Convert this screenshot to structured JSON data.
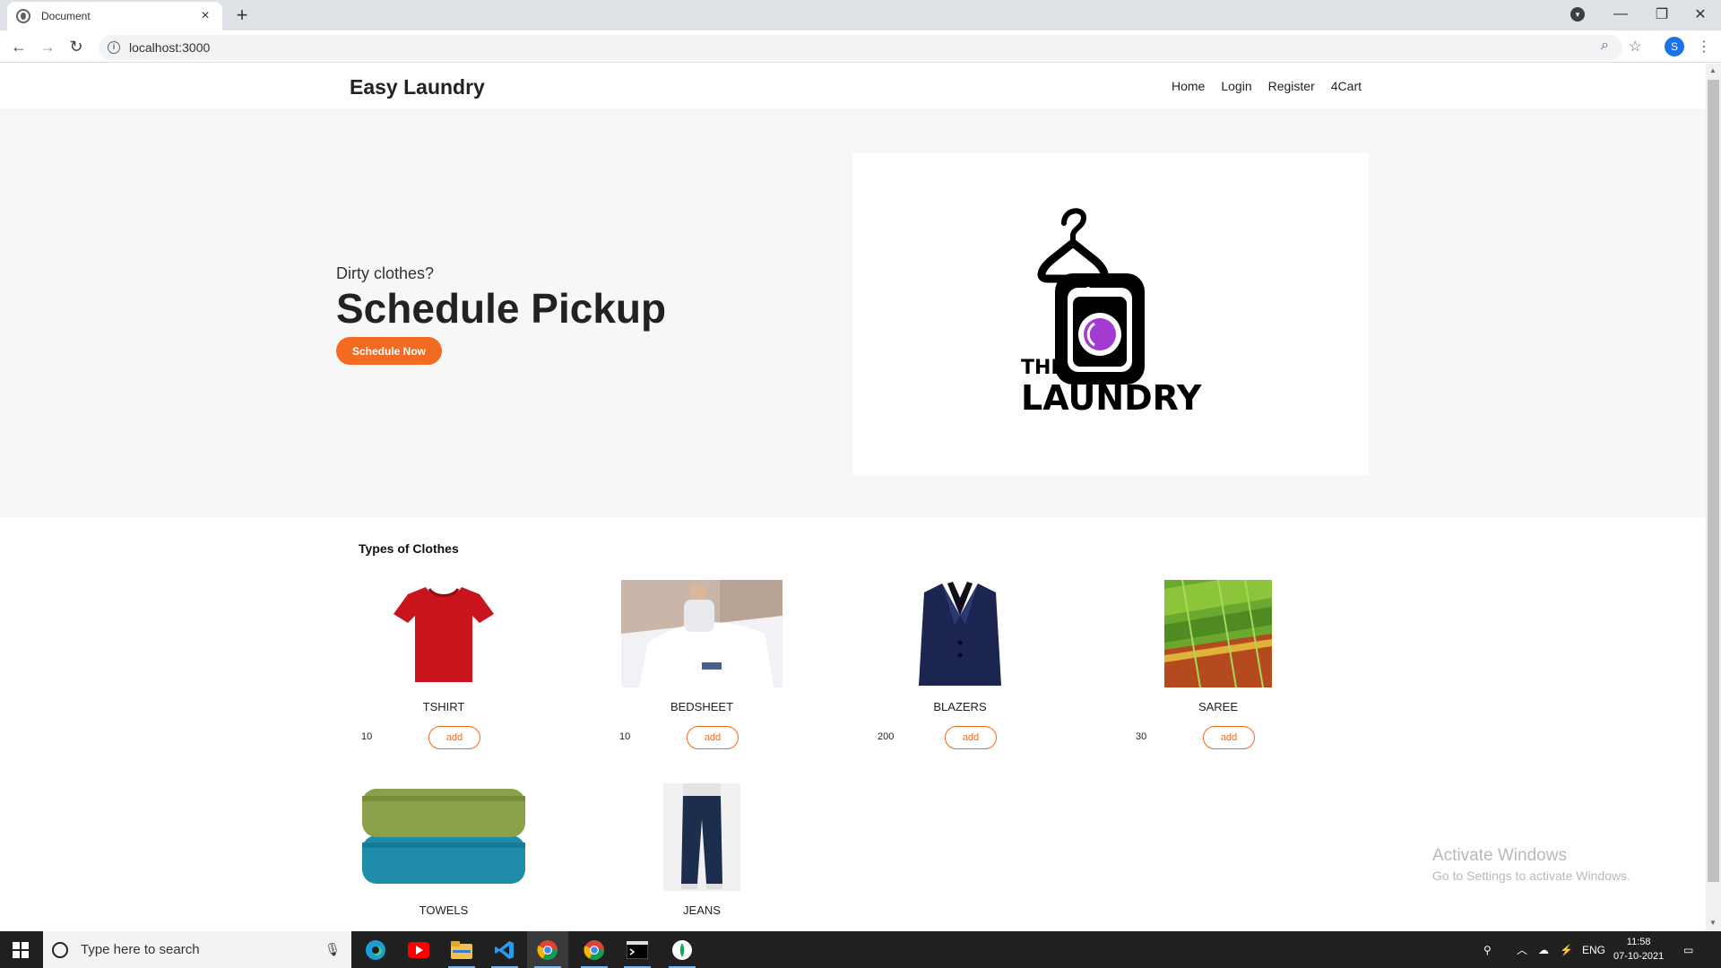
{
  "browser": {
    "tab_title": "Document",
    "tab_close": "×",
    "new_tab": "+",
    "url": "localhost:3000",
    "profile_initial": "S",
    "window_controls": [
      "minimize-icon",
      "restore-icon",
      "close-icon"
    ]
  },
  "site": {
    "brand": "Easy Laundry",
    "nav": [
      "Home",
      "Login",
      "Register",
      "4Cart"
    ]
  },
  "hero": {
    "subtitle": "Dirty clothes?",
    "title": "Schedule Pickup",
    "cta": "Schedule Now",
    "logo_line1": "THE",
    "logo_line2": "LAUNDRY"
  },
  "clothes": {
    "section_title": "Types of Clothes",
    "items": [
      {
        "name": "TSHIRT",
        "price": "10",
        "action": "add"
      },
      {
        "name": "BEDSHEET",
        "price": "10",
        "action": "add"
      },
      {
        "name": "BLAZERS",
        "price": "200",
        "action": "add"
      },
      {
        "name": "SAREE",
        "price": "30",
        "action": "add"
      },
      {
        "name": "TOWELS"
      },
      {
        "name": "JEANS"
      }
    ]
  },
  "watermark": {
    "line1": "Activate Windows",
    "line2": "Go to Settings to activate Windows."
  },
  "taskbar": {
    "search_placeholder": "Type here to search",
    "apps": [
      "edge-icon",
      "youtube-icon",
      "file-explorer-icon",
      "vscode-icon",
      "chrome-icon",
      "chrome-icon",
      "terminal-icon",
      "mongodb-compass-icon"
    ],
    "language": "ENG",
    "time": "11:58",
    "date": "07-10-2021"
  },
  "colors": {
    "accent": "#f26b21",
    "hero_bg": "#f7f7f7",
    "logo_purple": "#a43bd1"
  }
}
